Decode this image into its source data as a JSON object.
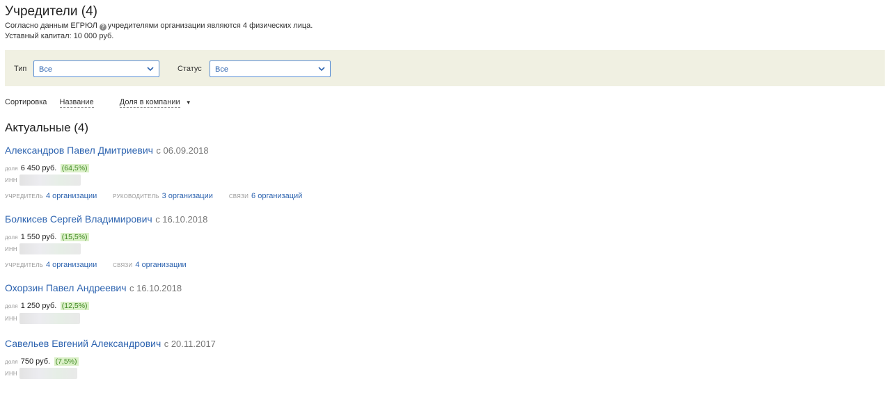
{
  "header": {
    "title": "Учредители (4)",
    "info_prefix": "Согласно данным ЕГРЮЛ",
    "info_suffix": "учредителями организации являются 4 физических лица.",
    "capital": "Уставный капитал: 10 000 руб."
  },
  "filters": {
    "type_label": "Тип",
    "type_value": "Все",
    "status_label": "Статус",
    "status_value": "Все"
  },
  "sort": {
    "label": "Сортировка",
    "by_name": "Название",
    "by_share": "Доля в компании",
    "arrow": "▼"
  },
  "section_title": "Актуальные (4)",
  "labels": {
    "share": "доля",
    "inn": "ИНН",
    "founder": "УЧРЕДИТЕЛЬ",
    "director": "РУКОВОДИТЕЛЬ",
    "links": "СВЯЗИ"
  },
  "founders": [
    {
      "name": "Александров Павел Дмитриевич",
      "since": "с 06.09.2018",
      "amount": "6 450 руб.",
      "percent": "(64,5%)",
      "founder_of": "4 организации",
      "director_of": "3 организации",
      "links_to": "6 организаций"
    },
    {
      "name": "Болкисев Сергей Владимирович",
      "since": "с 16.10.2018",
      "amount": "1 550 руб.",
      "percent": "(15,5%)",
      "founder_of": "4 организации",
      "links_to": "4 организации"
    },
    {
      "name": "Охорзин Павел Андреевич",
      "since": "с 16.10.2018",
      "amount": "1 250 руб.",
      "percent": "(12,5%)"
    },
    {
      "name": "Савельев Евгений Александрович",
      "since": "с 20.11.2017",
      "amount": "750 руб.",
      "percent": "(7,5%)"
    }
  ],
  "colors": {
    "link": "#2e64b0",
    "filter_bg": "#f0f0e2",
    "percent_bg": "#dbf0c8",
    "percent_text": "#3f8a22"
  }
}
